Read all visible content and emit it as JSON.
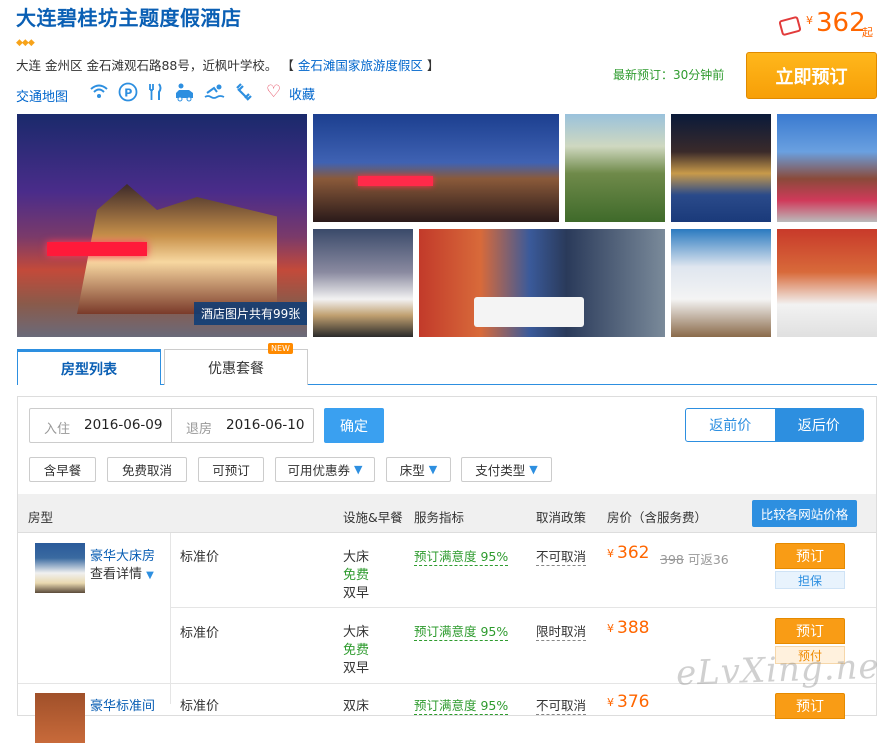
{
  "hotel": {
    "title": "大连碧桂坊主题度假酒店",
    "stars": "◆◆◆",
    "address": "大连 金州区 金石滩观石路88号，近枫叶学校。",
    "bracket_open": "【",
    "area_link": "金石滩国家旅游度假区",
    "bracket_close": "】",
    "map_link": "交通地图",
    "favorite": "收藏",
    "amenity_icons": [
      "wifi-icon",
      "parking-icon",
      "restaurant-icon",
      "car-rental-icon",
      "swimming-icon",
      "gym-icon"
    ]
  },
  "price_summary": {
    "currency": "¥",
    "value": "362",
    "suffix": "起",
    "recent_booking": "最新预订：30分钟前",
    "book_now": "立即预订"
  },
  "gallery": {
    "photo_count": "酒店图片共有99张"
  },
  "tabs": [
    {
      "label": "房型列表",
      "active": true
    },
    {
      "label": "优惠套餐",
      "active": false,
      "badge": "NEW"
    }
  ],
  "search": {
    "checkin_label": "入住",
    "checkin": "2016-06-09",
    "checkout_label": "退房",
    "checkout": "2016-06-10",
    "confirm": "确定",
    "toggle": [
      "返前价",
      "返后价"
    ],
    "toggle_selected": "返后价"
  },
  "filters": [
    {
      "label": "含早餐",
      "dropdown": false
    },
    {
      "label": "免费取消",
      "dropdown": false
    },
    {
      "label": "可预订",
      "dropdown": false
    },
    {
      "label": "可用优惠券",
      "dropdown": true
    },
    {
      "label": "床型",
      "dropdown": true
    },
    {
      "label": "支付类型",
      "dropdown": true
    }
  ],
  "table": {
    "headers": {
      "room_type": "房型",
      "facilities": "设施&早餐",
      "service": "服务指标",
      "cancel": "取消政策",
      "price": "房价（含服务费）",
      "compare": "比较各网站价格"
    },
    "rooms": [
      {
        "name": "豪华大床房",
        "details": "查看详情",
        "rates": [
          {
            "rate_name": "标准价",
            "bed": "大床",
            "wifi": "免费",
            "breakfast": "双早",
            "satisfaction": "预订满意度 95%",
            "cancel": "不可取消",
            "currency": "¥",
            "price": "362",
            "original": "398",
            "cashback": "可返36",
            "book": "预订",
            "pay_type": "担保"
          },
          {
            "rate_name": "标准价",
            "bed": "大床",
            "wifi": "免费",
            "breakfast": "双早",
            "satisfaction": "预订满意度 95%",
            "cancel": "限时取消",
            "currency": "¥",
            "price": "388",
            "book": "预订",
            "pay_type": "预付"
          }
        ]
      },
      {
        "name": "豪华标准间",
        "rates": [
          {
            "rate_name": "标准价",
            "bed": "双床",
            "satisfaction": "预订满意度 95%",
            "cancel": "不可取消",
            "currency": "¥",
            "price": "376",
            "book": "预订"
          }
        ]
      }
    ]
  },
  "watermark": "eLvXing.net",
  "colors": {
    "brand_blue": "#2d8fe0",
    "price_orange": "#ff6600",
    "book_button": "#f99c15",
    "green": "#2e9b2e"
  }
}
